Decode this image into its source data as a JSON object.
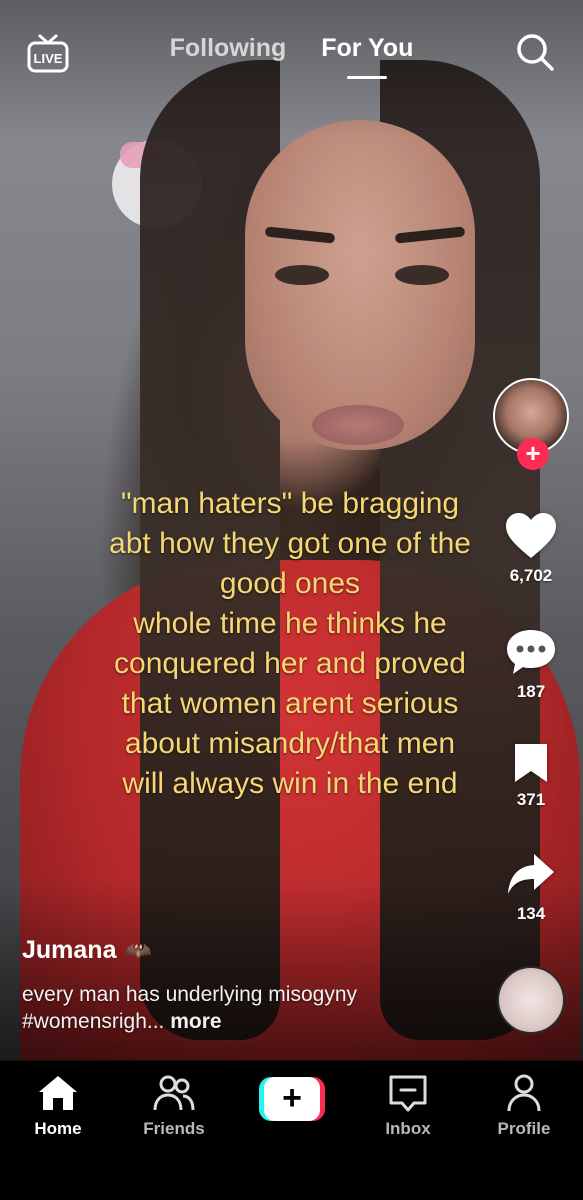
{
  "top_bar": {
    "live_label": "LIVE",
    "tabs": [
      {
        "label": "Following",
        "active": false
      },
      {
        "label": "For You",
        "active": true
      }
    ],
    "search_icon": "search-icon"
  },
  "overlay_caption": {
    "lines": [
      "\"man haters\" be bragging",
      "abt how they got one of the",
      "good ones",
      "whole time he thinks he",
      "conquered her and proved",
      "that women arent serious",
      "about misandry/that men",
      "will always win in the end"
    ],
    "color": "#f5d774"
  },
  "rail": {
    "like_count": "6,702",
    "comment_count": "187",
    "save_count": "371",
    "share_count": "134",
    "follow_color": "#fe2c55"
  },
  "post": {
    "author": "Jumana",
    "author_emoji": "🦇",
    "description": "every man has underlying misogyny #womensrigh...",
    "more_label": "more"
  },
  "bottom_nav": {
    "items": [
      {
        "label": "Home",
        "icon": "home-icon",
        "active": true
      },
      {
        "label": "Friends",
        "icon": "friends-icon",
        "active": false
      },
      {
        "label": "",
        "icon": "create-plus-icon",
        "active": false
      },
      {
        "label": "Inbox",
        "icon": "inbox-icon",
        "active": false
      },
      {
        "label": "Profile",
        "icon": "profile-icon",
        "active": false
      }
    ],
    "create_symbol": "+"
  }
}
